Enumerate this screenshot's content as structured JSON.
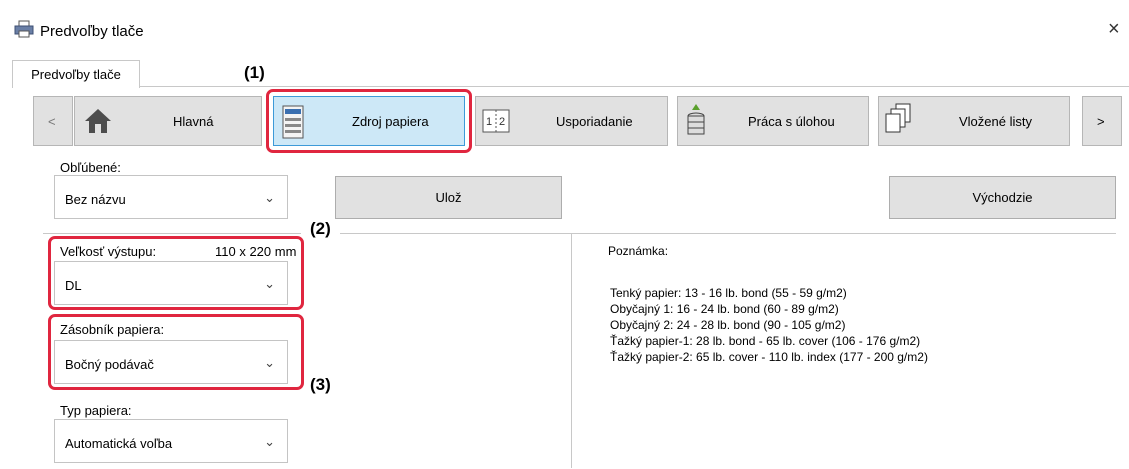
{
  "window": {
    "title": "Predvoľby tlače",
    "close_glyph": "×"
  },
  "tabs": [
    {
      "label": "Predvoľby tlače"
    }
  ],
  "nav": {
    "prev": "<",
    "next": ">",
    "buttons": [
      {
        "label": "Hlavná",
        "icon": "home-icon"
      },
      {
        "label": "Zdroj papiera",
        "icon": "paper-tray-icon"
      },
      {
        "label": "Usporiadanie",
        "icon": "layout-icon"
      },
      {
        "label": "Práca s úlohou",
        "icon": "job-stack-icon"
      },
      {
        "label": "Vložené listy",
        "icon": "inserted-sheets-icon"
      }
    ]
  },
  "favorites": {
    "label": "Obľúbené:",
    "value": "Bez názvu"
  },
  "buttons": {
    "save": "Ulož",
    "defaults": "Východzie"
  },
  "output_size": {
    "label": "Veľkosť výstupu:",
    "size_value": "110 x 220 mm",
    "value": "DL"
  },
  "paper_tray": {
    "label": "Zásobník papiera:",
    "value": "Bočný podávač"
  },
  "paper_type": {
    "label": "Typ papiera:",
    "value": "Automatická voľba"
  },
  "note": {
    "label": "Poznámka:",
    "lines": [
      "Tenký papier: 13 - 16 lb. bond (55 - 59 g/m2)",
      "Obyčajný 1: 16 - 24 lb. bond (60 - 89 g/m2)",
      "Obyčajný 2: 24 - 28 lb. bond (90 - 105 g/m2)",
      "Ťažký papier-1: 28 lb. bond - 65 lb. cover (106 - 176 g/m2)",
      "Ťažký papier-2: 65 lb. cover - 110 lb. index (177 - 200 g/m2)"
    ]
  },
  "callouts": {
    "c1": "(1)",
    "c2": "(2)",
    "c3": "(3)"
  },
  "colors": {
    "highlight": "#e0263f",
    "active_button": "#cde8f7",
    "button": "#e1e1e1"
  }
}
